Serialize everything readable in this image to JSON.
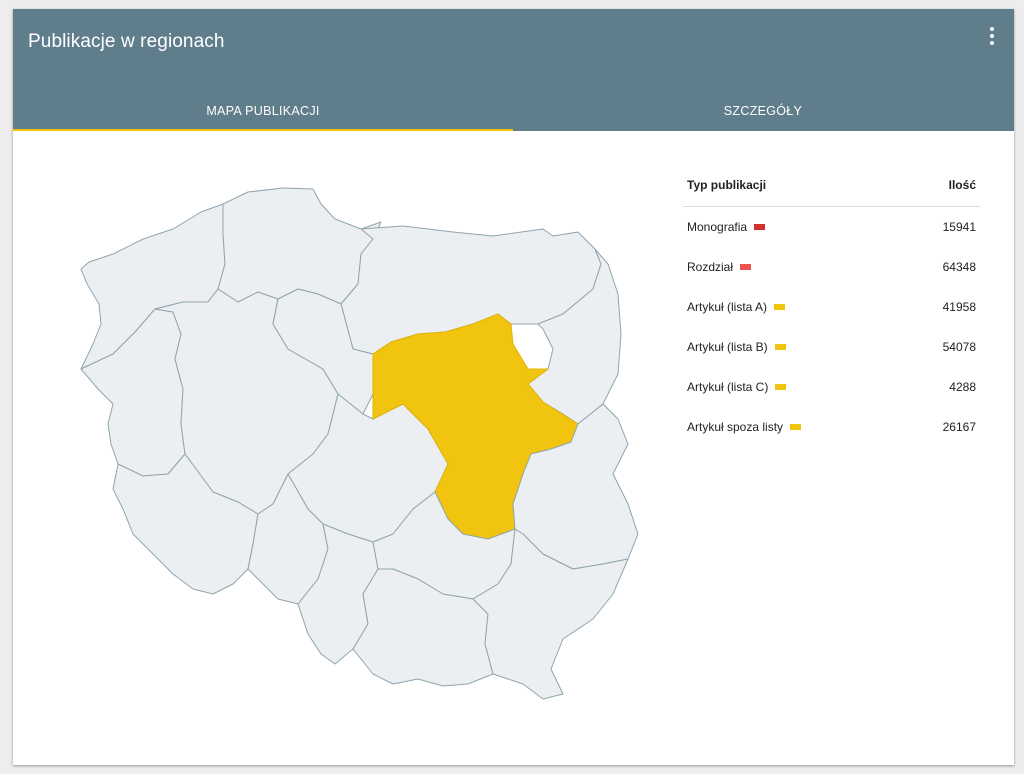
{
  "header": {
    "title": "Publikacje w regionach",
    "menu_icon": "more-vert-icon"
  },
  "tabs": [
    {
      "label": "MAPA PUBLIKACJI",
      "active": true
    },
    {
      "label": "SZCZEGÓŁY",
      "active": false
    }
  ],
  "colors": {
    "header_bg": "#607d8b",
    "tab_indicator": "#f1c40f",
    "region_fill": "#eceff1",
    "region_stroke": "#90a4ae",
    "selected_region_fill": "#f1c40f"
  },
  "map": {
    "selected_region": "mazowieckie"
  },
  "legend": {
    "header": {
      "type_label": "Typ publikacji",
      "count_label": "Ilość"
    },
    "rows": [
      {
        "name": "Monografia",
        "count": "15941",
        "color": "#d32f2f"
      },
      {
        "name": "Rozdział",
        "count": "64348",
        "color": "#ef5350"
      },
      {
        "name": "Artykuł (lista A)",
        "count": "41958",
        "color": "#f1c40f"
      },
      {
        "name": "Artykuł (lista B)",
        "count": "54078",
        "color": "#f1c40f"
      },
      {
        "name": "Artykuł (lista C)",
        "count": "4288",
        "color": "#f1c40f"
      },
      {
        "name": "Artykuł spoza listy",
        "count": "26167",
        "color": "#f1c40f"
      }
    ]
  }
}
